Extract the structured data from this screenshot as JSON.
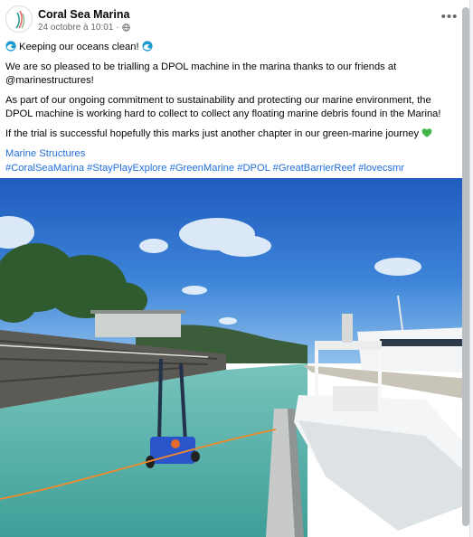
{
  "post": {
    "page_name": "Coral Sea Marina",
    "date": "24 octobre à 10:01",
    "separator": "·",
    "more_label": "•••",
    "headline": "Keeping our oceans clean!",
    "paragraph1": "We are so pleased to be trialling a DPOL machine in the marina thanks to our friends at @marinestructures!",
    "paragraph2": "As part of our ongoing commitment to sustainability and protecting our marine environment, the DPOL machine is working hard to collect to collect any floating marine debris found in the Marina!",
    "paragraph3": "If the trial is successful hopefully this marks just another chapter in our green-marine journey",
    "mention_link": "Marine Structures",
    "hashtags": [
      "#CoralSeaMarina",
      "#StayPlayExplore",
      "#GreenMarine",
      "#DPOL",
      "#GreatBarrierReef",
      "#lovecsmr"
    ]
  },
  "icons": {
    "headline_emoji": "water-wave-icon",
    "heart_emoji": "green-heart-icon",
    "privacy": "globe-icon",
    "menu": "more-options-icon"
  },
  "colors": {
    "link": "#216fdb",
    "meta_text": "#65676b",
    "water": "#5fb9b0",
    "sky": "#2a67c4"
  }
}
